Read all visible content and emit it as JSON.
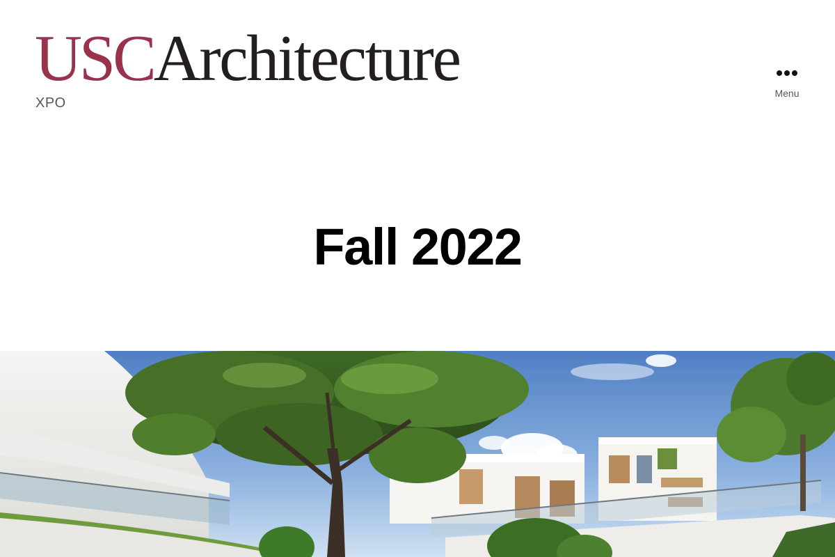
{
  "header": {
    "logo_usc": "USC",
    "logo_architecture": "Architecture",
    "site_description": "XPO",
    "menu_label": "Menu",
    "menu_icon": "horizontal-ellipsis-icon"
  },
  "page": {
    "title": "Fall 2022"
  },
  "colors": {
    "brand_cardinal": "#99324c",
    "logo_dark": "#231f20",
    "title": "#000000",
    "muted_text": "#55595e"
  }
}
